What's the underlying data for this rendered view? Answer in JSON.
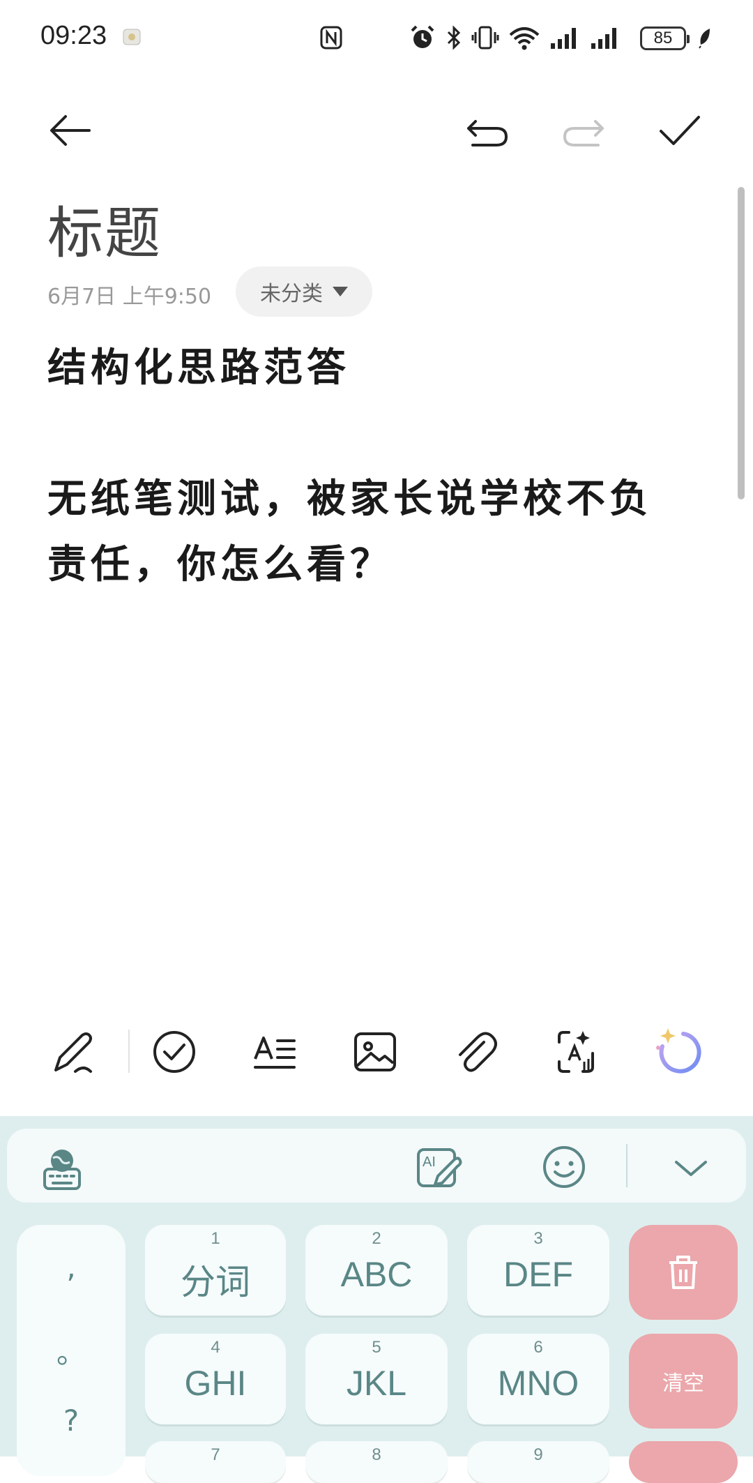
{
  "status_bar": {
    "time": "09:23",
    "battery": "85",
    "icons": [
      "nfc-icon",
      "alarm-icon",
      "bluetooth-icon",
      "vibrate-icon",
      "wifi-icon",
      "signal-icon",
      "signal-icon"
    ]
  },
  "toolbar": {
    "back": "back-arrow-icon",
    "undo": "undo-icon",
    "redo": "redo-icon",
    "done": "check-icon"
  },
  "note": {
    "title": "标题",
    "date": "6月7日 上午9:50",
    "category": "未分类",
    "body_line1": "结构化思路范答",
    "body_line2": "无纸笔测试，被家长说学校不负",
    "body_line3": "责任，你怎么看？"
  },
  "bottom_toolbar": [
    "handwriting-icon",
    "checklist-icon",
    "text-format-icon",
    "image-icon",
    "attachment-icon",
    "scan-text-icon",
    "ai-assistant-icon"
  ],
  "keyboard": {
    "top_icons": [
      "keyboard-globe-icon",
      "ai-write-icon",
      "emoji-icon",
      "collapse-icon"
    ],
    "punct": [
      ",",
      "。",
      "?"
    ],
    "keys": [
      {
        "num": "1",
        "label": "分词"
      },
      {
        "num": "2",
        "label": "ABC"
      },
      {
        "num": "3",
        "label": "DEF"
      },
      {
        "num": "4",
        "label": "GHI"
      },
      {
        "num": "5",
        "label": "JKL"
      },
      {
        "num": "6",
        "label": "MNO"
      },
      {
        "num": "7",
        "label": ""
      },
      {
        "num": "8",
        "label": ""
      },
      {
        "num": "9",
        "label": ""
      }
    ],
    "clear_label": "清空"
  },
  "colors": {
    "keyboard_bg": "#deeeee",
    "key_bg": "#f6fbfb",
    "key_text": "#5a8686",
    "delete_bg": "#eba7ab"
  }
}
